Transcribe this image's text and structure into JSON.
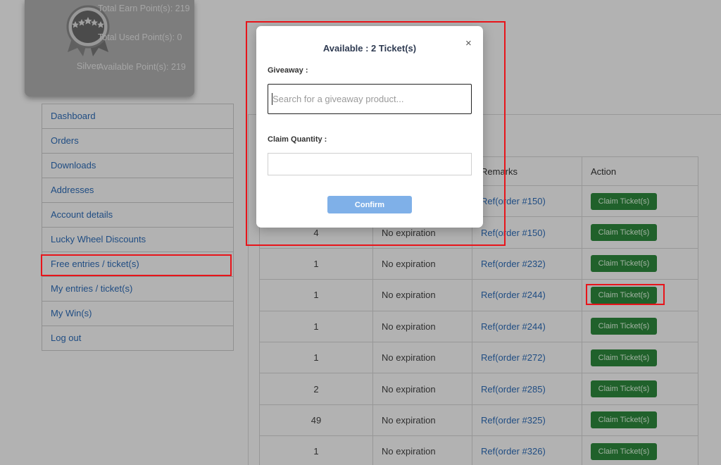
{
  "points": {
    "tier": "Silver",
    "total_earn": "Total Earn Point(s): 219",
    "total_used": "Total Used Point(s): 0",
    "available": "Available Point(s): 219",
    "medal_icon": "silver-medal-icon",
    "colors": {
      "card": "#b3b3b3",
      "text": "#ececec"
    }
  },
  "menu": {
    "items": [
      {
        "label": "Dashboard"
      },
      {
        "label": "Orders"
      },
      {
        "label": "Downloads"
      },
      {
        "label": "Addresses"
      },
      {
        "label": "Account details"
      },
      {
        "label": "Lucky Wheel Discounts"
      },
      {
        "label": "Free entries / ticket(s)",
        "active": true
      },
      {
        "label": "My entries / ticket(s)"
      },
      {
        "label": "My Win(s)"
      },
      {
        "label": "Log out"
      }
    ]
  },
  "table": {
    "headers": {
      "qty": "",
      "expiry": "",
      "remarks": "Remarks",
      "action": "Action"
    },
    "rows": [
      {
        "qty": "",
        "expiry": "",
        "remarks": "Ref(order #150)",
        "action": "Claim Ticket(s)"
      },
      {
        "qty": "4",
        "expiry": "No expiration",
        "remarks": "Ref(order #150)",
        "action": "Claim Ticket(s)"
      },
      {
        "qty": "1",
        "expiry": "No expiration",
        "remarks": "Ref(order #232)",
        "action": "Claim Ticket(s)"
      },
      {
        "qty": "1",
        "expiry": "No expiration",
        "remarks": "Ref(order #244)",
        "action": "Claim Ticket(s)"
      },
      {
        "qty": "1",
        "expiry": "No expiration",
        "remarks": "Ref(order #244)",
        "action": "Claim Ticket(s)"
      },
      {
        "qty": "1",
        "expiry": "No expiration",
        "remarks": "Ref(order #272)",
        "action": "Claim Ticket(s)"
      },
      {
        "qty": "2",
        "expiry": "No expiration",
        "remarks": "Ref(order #285)",
        "action": "Claim Ticket(s)"
      },
      {
        "qty": "49",
        "expiry": "No expiration",
        "remarks": "Ref(order #325)",
        "action": "Claim Ticket(s)"
      },
      {
        "qty": "1",
        "expiry": "No expiration",
        "remarks": "Ref(order #326)",
        "action": "Claim Ticket(s)"
      }
    ]
  },
  "modal": {
    "title": "Available : 2 Ticket(s)",
    "close_symbol": "×",
    "giveaway_label": "Giveaway :",
    "search_placeholder": "Search for a giveaway product...",
    "search_value": "",
    "quantity_label": "Claim Quantity :",
    "quantity_value": "",
    "confirm_label": "Confirm"
  },
  "colors": {
    "link": "#2f6fbc",
    "claim_button": "#2e8b3e",
    "confirm_button": "#7fb0e8",
    "highlight": "#e8141a"
  }
}
